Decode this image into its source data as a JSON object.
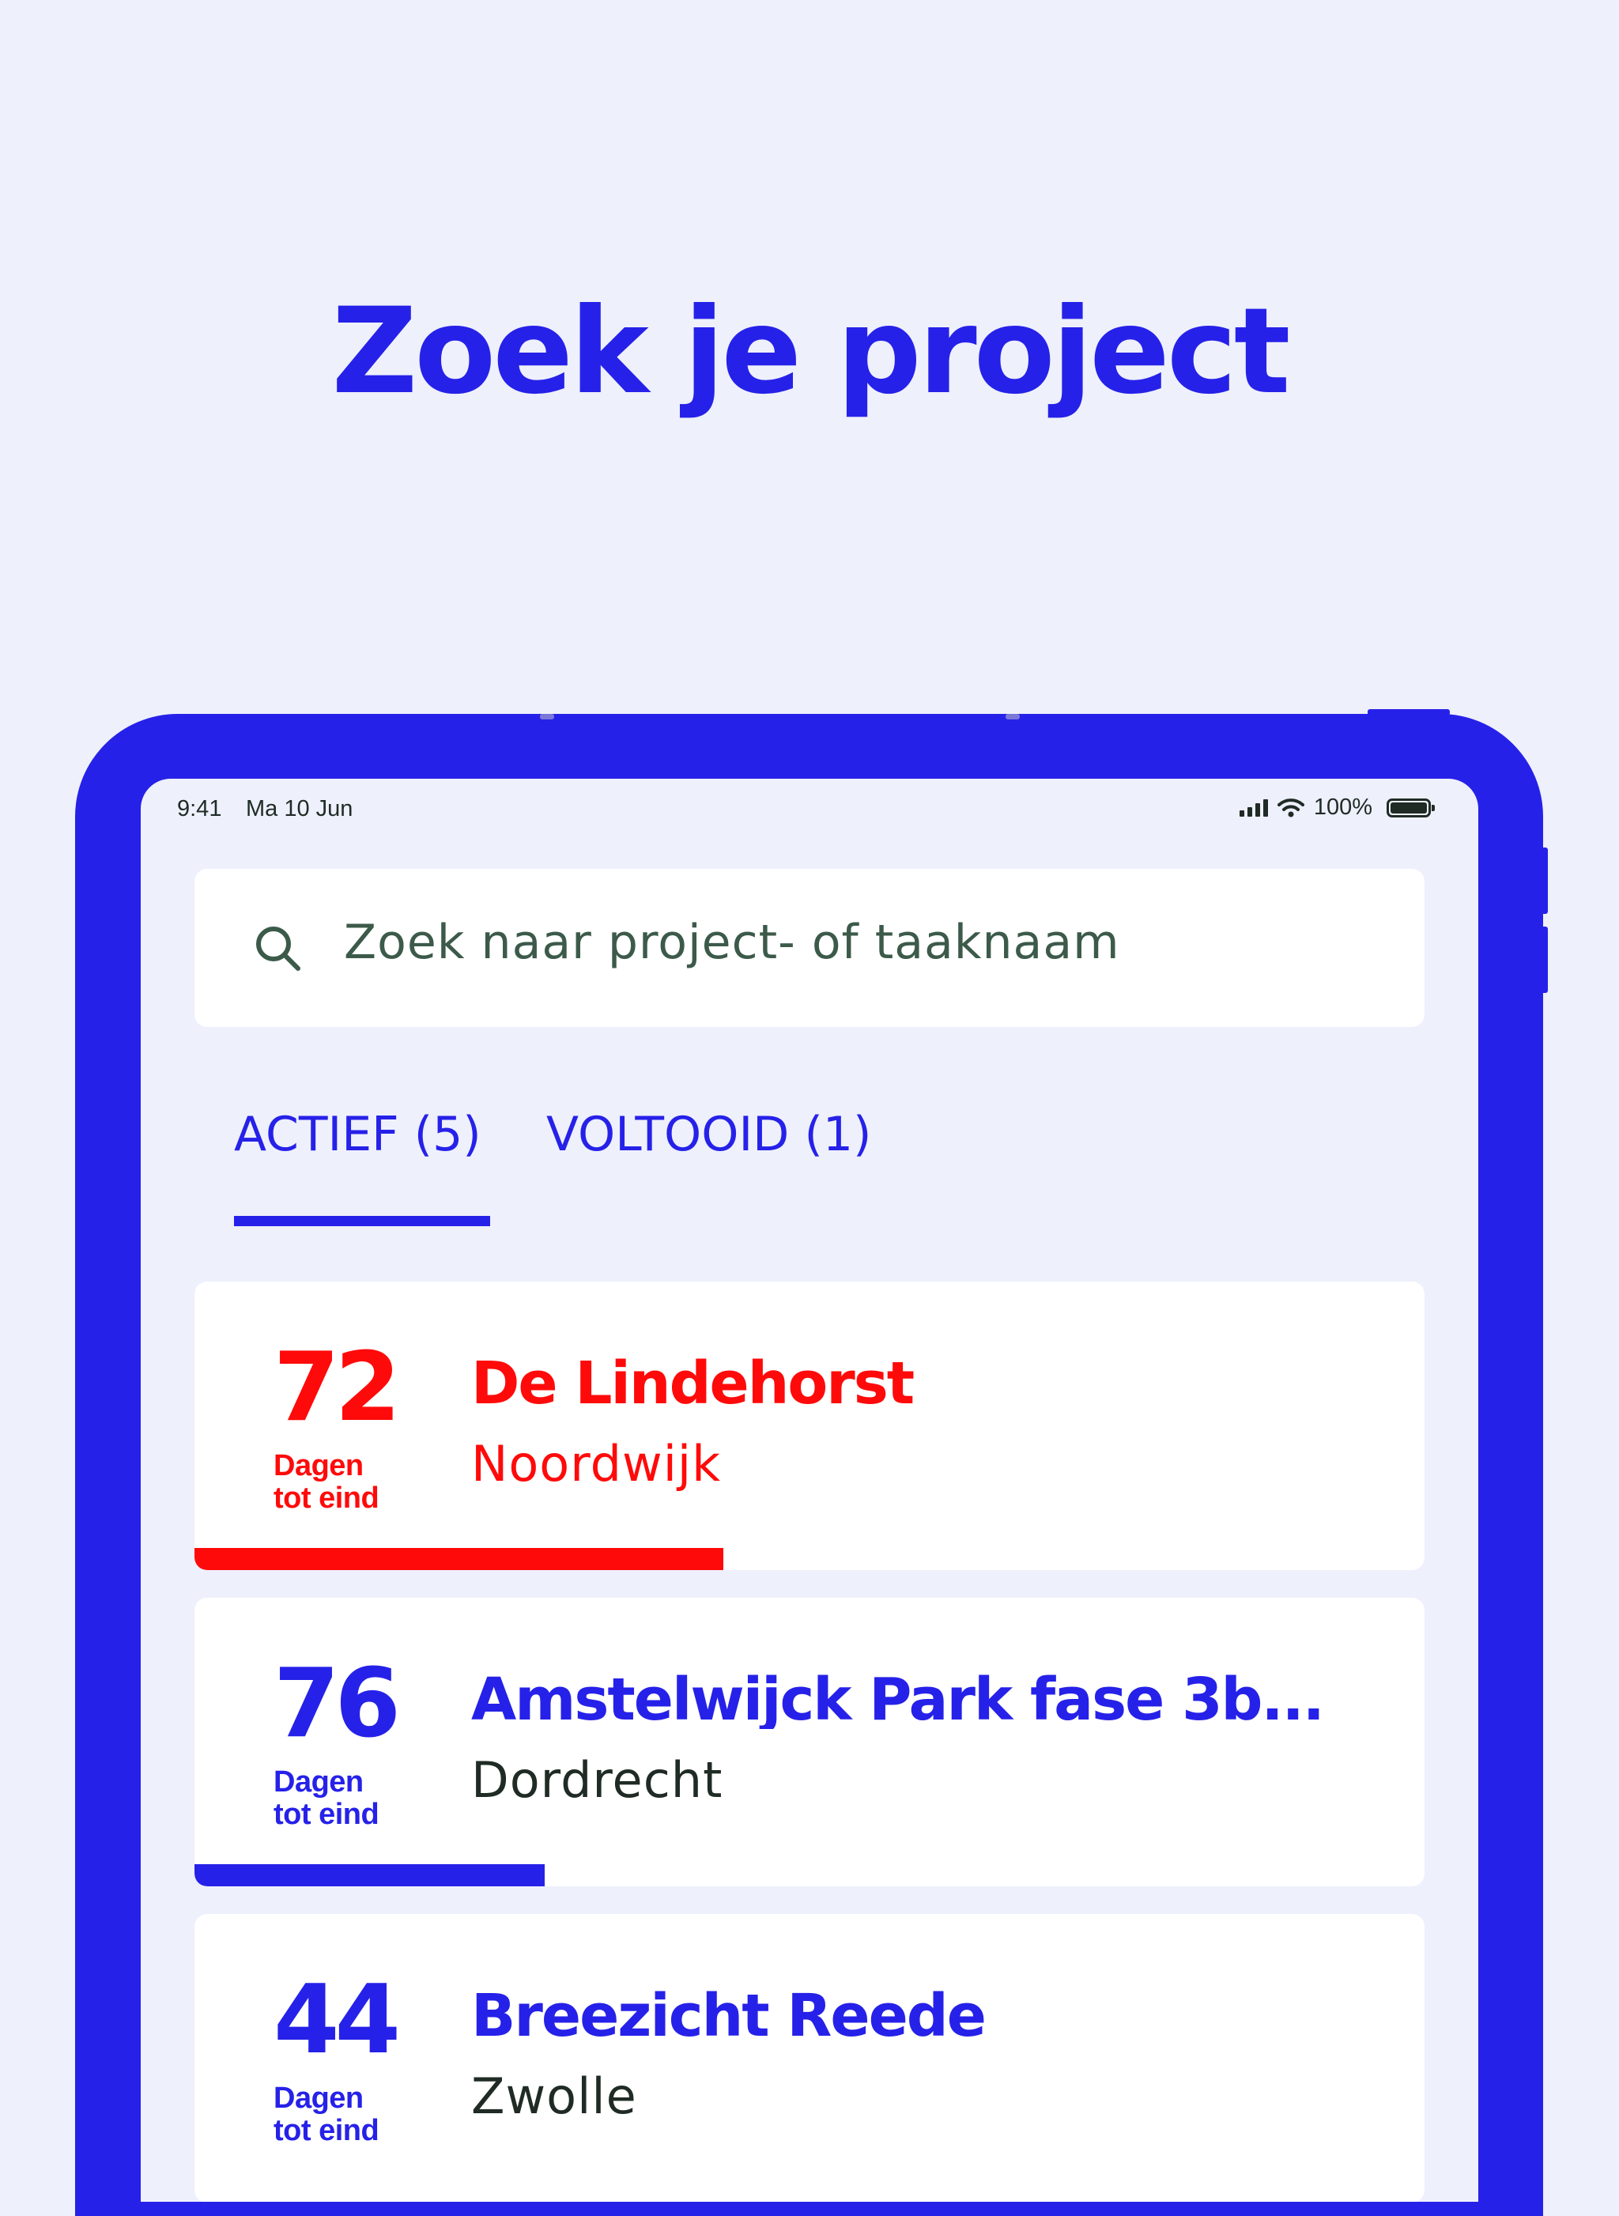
{
  "headline": "Zoek je project",
  "status_bar": {
    "time": "9:41",
    "date": "Ma 10 Jun",
    "battery": "100%"
  },
  "search": {
    "placeholder": "Zoek naar project- of taaknaam"
  },
  "tabs": [
    {
      "label": "ACTIEF (5)",
      "active": true
    },
    {
      "label": "VOLTOOID (1)",
      "active": false
    }
  ],
  "projects": [
    {
      "days": "72",
      "days_label_1": "Dagen",
      "days_label_2": "tot eind",
      "name": "De Lindehorst",
      "city": "Noordwijk",
      "progress": 0.43,
      "color": "#ff0a0a",
      "city_color": "#ff0a0a"
    },
    {
      "days": "76",
      "days_label_1": "Dagen",
      "days_label_2": "tot eind",
      "name": "Amstelwijck Park fase 3b...",
      "city": "Dordrecht",
      "progress": 0.285,
      "color": "#2621e8",
      "city_color": "#1f2b24"
    },
    {
      "days": "44",
      "days_label_1": "Dagen",
      "days_label_2": "tot eind",
      "name": "Breezicht Reede",
      "city": "Zwolle",
      "progress": null,
      "color": "#2621e8",
      "city_color": "#1f2b24"
    }
  ],
  "colors": {
    "accent": "#2621e8",
    "alert": "#ff0a0a",
    "background": "#eef0fc",
    "text_dark": "#1f2b24"
  }
}
